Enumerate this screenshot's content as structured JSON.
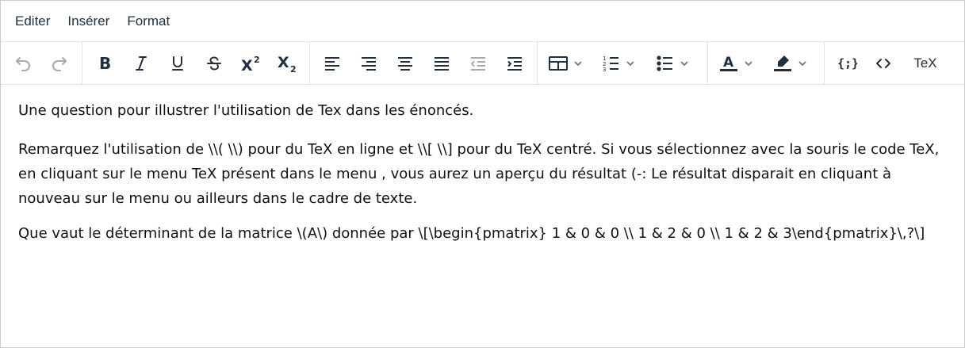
{
  "menubar": {
    "items": [
      {
        "label": "Editer"
      },
      {
        "label": "Insérer"
      },
      {
        "label": "Format"
      }
    ]
  },
  "toolbar": {
    "tex_label": "TeX",
    "icons": [
      "undo-icon",
      "redo-icon",
      "bold-icon",
      "italic-icon",
      "underline-icon",
      "strikethrough-icon",
      "superscript-icon",
      "subscript-icon",
      "align-left-icon",
      "align-right-icon",
      "align-center-icon",
      "align-justify-icon",
      "outdent-icon",
      "indent-icon",
      "table-icon",
      "numbered-list-icon",
      "bullet-list-icon",
      "text-color-icon",
      "highlight-icon",
      "code-sample-icon",
      "source-code-icon"
    ]
  },
  "content": {
    "paragraphs": [
      "Une question pour illustrer l'utilisation de Tex dans les énoncés.",
      "Remarquez l'utilisation de \\\\( \\\\) pour du TeX en ligne et \\\\[ \\\\] pour du TeX centré. Si vous sélectionnez avec la souris le code TeX, en cliquant sur le menu TeX présent dans le menu , vous aurez un aperçu du résultat (-: Le résultat disparait en cliquant à nouveau sur le menu ou ailleurs dans le cadre de texte.",
      "Que vaut le déterminant de la matrice \\(A\\) donnée par \\[\\begin{pmatrix} 1 & 0 & 0 \\\\ 1 & 2 & 0 \\\\ 1 & 2 & 3\\end{pmatrix}\\,?\\]"
    ]
  }
}
